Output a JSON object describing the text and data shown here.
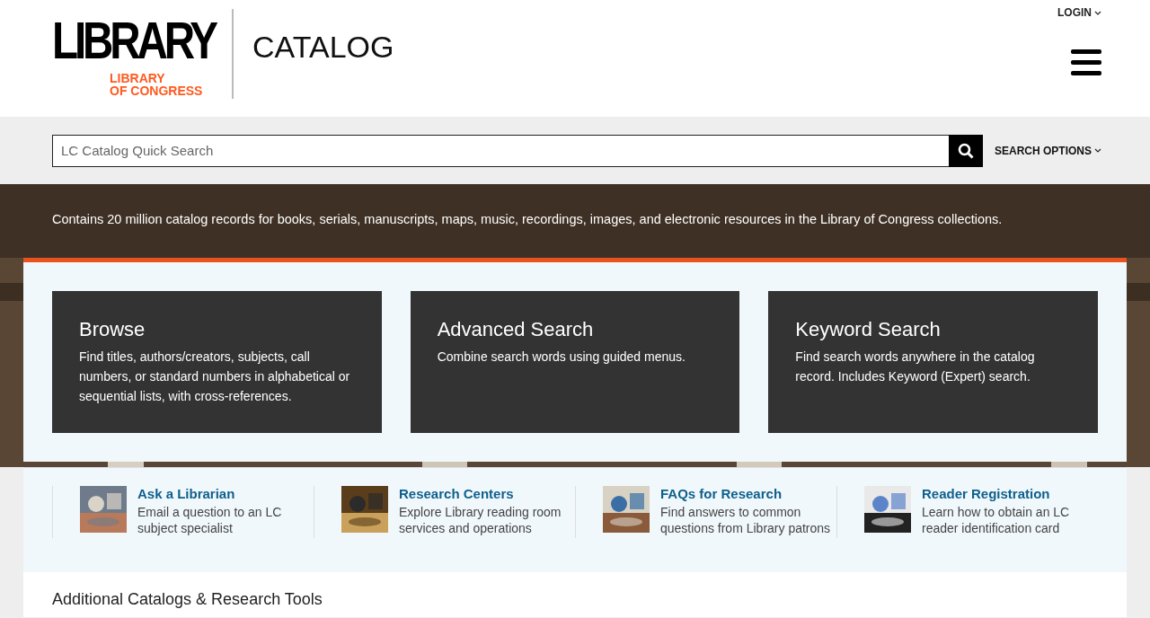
{
  "logo": {
    "wordmark": "LIBRARY",
    "subline_1": "LIBRARY",
    "subline_2": "OF CONGRESS"
  },
  "site_title": "CATALOG",
  "login": "LOGIN",
  "search": {
    "placeholder": "LC Catalog Quick Search",
    "options": "SEARCH OPTIONS"
  },
  "hero_text": "Contains 20 million catalog records for books, serials, manuscripts, maps, music, recordings, images, and electronic resources in the Library of Congress collections.",
  "cards": [
    {
      "title": "Browse",
      "text": "Find titles, authors/creators, subjects, call numbers, or standard numbers in alphabetical or sequential lists, with cross-references."
    },
    {
      "title": "Advanced Search",
      "text": "Combine search words using guided menus."
    },
    {
      "title": "Keyword Search",
      "text": "Find search words anywhere in the catalog record. Includes Keyword (Expert) search."
    }
  ],
  "links": [
    {
      "title": "Ask a Librarian",
      "text": "Email a question to an LC subject specialist",
      "kind": "mural"
    },
    {
      "title": "Research Centers",
      "text": "Explore Library reading room services and operations",
      "kind": "room"
    },
    {
      "title": "FAQs for Research",
      "text": "Find answers to common questions from Library patrons",
      "kind": "desk"
    },
    {
      "title": "Reader Registration",
      "text": "Learn how to obtain an LC reader identification card",
      "kind": "card"
    }
  ],
  "section_heading": "Additional Catalogs & Research Tools"
}
